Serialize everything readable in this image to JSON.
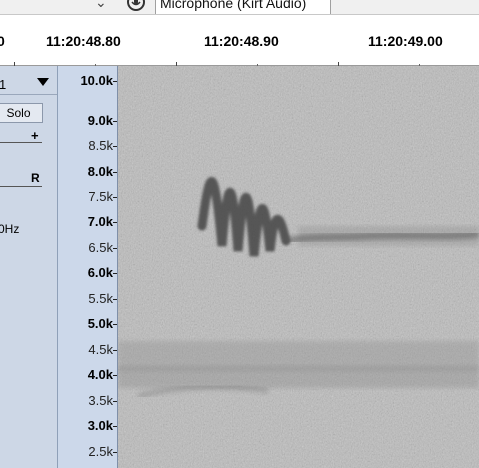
{
  "toolbar": {
    "device_chevron": "⌄",
    "recording_device": "Microphone (Kirt Audio)"
  },
  "timeline": {
    "left_partial": "0",
    "labels": [
      "11:20:48.80",
      "11:20:48.90",
      "11:20:49.00"
    ]
  },
  "track": {
    "name_partial": "1",
    "solo_label": "Solo",
    "gain_plus": "+",
    "pan_label": "R",
    "rate_partial": "0Hz"
  },
  "scale": {
    "labels": [
      "10.0k",
      "9.0k",
      "8.5k",
      "8.0k",
      "7.5k",
      "7.0k",
      "6.5k",
      "6.0k",
      "5.5k",
      "5.0k",
      "4.5k",
      "4.0k",
      "3.5k",
      "3.0k",
      "2.5k"
    ]
  },
  "colors": {
    "panel_bg": "#cdd7e6",
    "scale_bg": "#ccd8ea",
    "spectrogram_bg": "#b9b9b9",
    "signal": "#3f3f3f"
  }
}
